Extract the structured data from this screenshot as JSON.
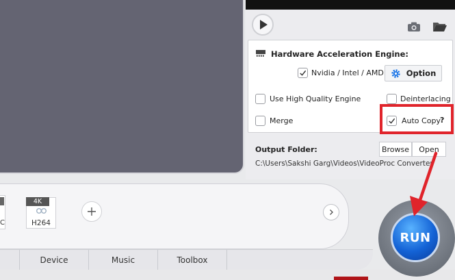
{
  "hardware": {
    "title": "Hardware Acceleration Engine:",
    "gpu_label": "Nvidia / Intel / AMD",
    "gpu_checked": true,
    "option_label": "Option"
  },
  "options": {
    "high_quality": {
      "label": "Use High Quality Engine",
      "checked": false
    },
    "deinterlacing": {
      "label": "Deinterlacing",
      "checked": false
    },
    "merge": {
      "label": "Merge",
      "checked": false
    },
    "auto_copy": {
      "label": "Auto Copy",
      "checked": true,
      "help": "?"
    }
  },
  "output": {
    "label": "Output Folder:",
    "browse_label": "Browse",
    "open_label": "Open",
    "path": "C:\\Users\\Sakshi Garg\\Videos\\VideoProc Converter"
  },
  "clips": {
    "partial_text": "C",
    "badge": "4K",
    "codec": "H264"
  },
  "tabs": [
    "Device",
    "Music",
    "Toolbox"
  ],
  "run_label": "RUN",
  "colors": {
    "accent_blue": "#1b76e8",
    "highlight_red": "#e0242b"
  },
  "icons": {
    "play": "play-icon",
    "camera": "camera-icon",
    "folder": "folder-icon",
    "chip": "chip-icon",
    "gear": "gear-icon",
    "add": "plus-icon",
    "next": "chevron-right-icon"
  }
}
